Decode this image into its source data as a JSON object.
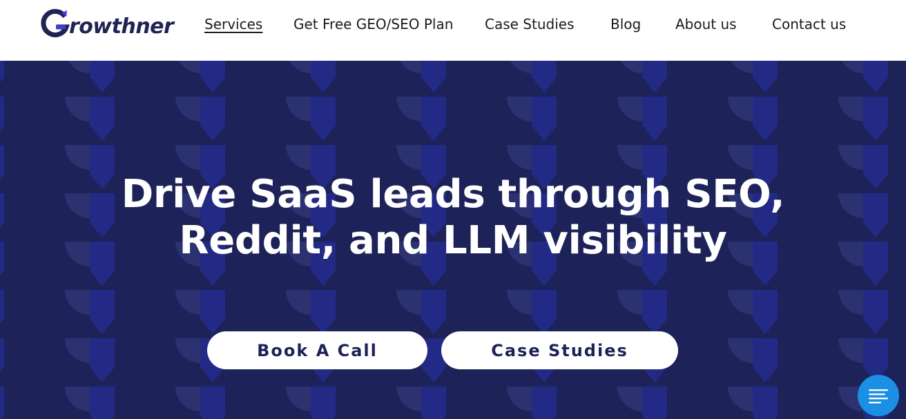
{
  "header": {
    "logo": {
      "text": "rowthner",
      "icon": "growthner-g-logo-icon",
      "brand_color": "#1f2452",
      "accent_color": "#3b3fd8"
    },
    "nav": [
      {
        "label": "Services",
        "active": true
      },
      {
        "label": "Get Free GEO/SEO Plan"
      },
      {
        "label": "Case Studies"
      },
      {
        "label": "Blog"
      },
      {
        "label": "About us"
      },
      {
        "label": "Contact us"
      }
    ]
  },
  "hero": {
    "background": "#1d2258",
    "headline_line1": "Drive SaaS leads through SEO,",
    "headline_line2": "Reddit, and LLM visibility",
    "buttons": {
      "book_call": "Book A Call",
      "case_studies": "Case Studies"
    }
  },
  "chat_widget": {
    "icon": "chat-lines-icon",
    "color": "#1a8fe3"
  }
}
